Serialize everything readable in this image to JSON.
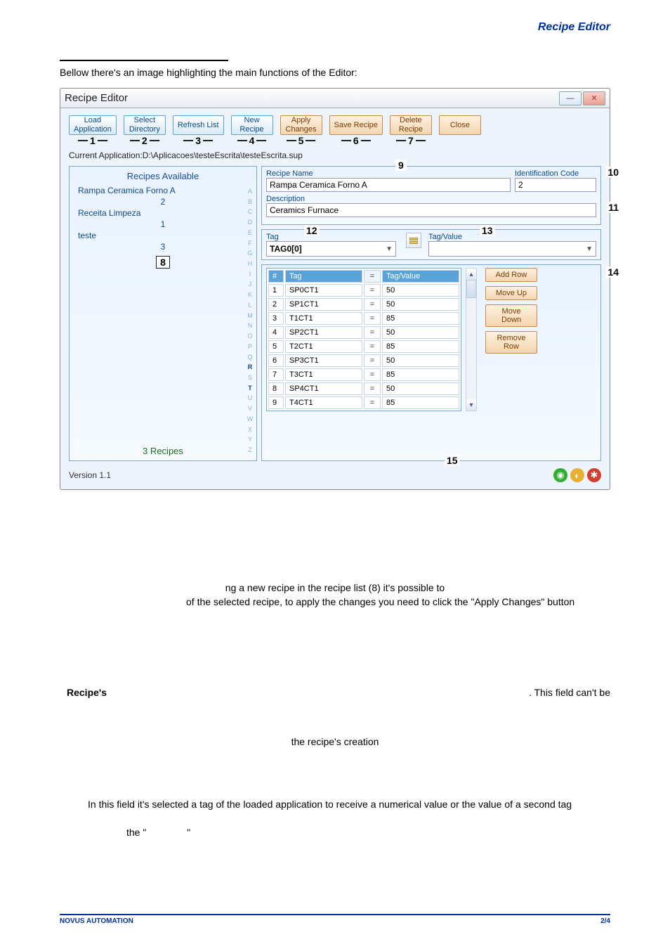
{
  "header": {
    "title": "Recipe Editor"
  },
  "intro": "Bellow there's an image highlighting the main functions of the Editor:",
  "win": {
    "title": "Recipe Editor",
    "toolbar": [
      {
        "label": "Load\nApplication",
        "num": "1",
        "warm": false
      },
      {
        "label": "Select\nDirectory",
        "num": "2",
        "warm": false
      },
      {
        "label": "Refresh List",
        "num": "3",
        "warm": false
      },
      {
        "label": "New\nRecipe",
        "num": "4",
        "warm": false
      },
      {
        "label": "Apply\nChanges",
        "num": "5",
        "warm": true
      },
      {
        "label": "Save Recipe",
        "num": "6",
        "warm": true
      },
      {
        "label": "Delete\nRecipe",
        "num": "7",
        "warm": true
      },
      {
        "label": "Close",
        "num": "",
        "warm": true
      }
    ],
    "path": "Current Application:D:\\Aplicacoes\\testeEscrita\\testeEscrita.sup",
    "left": {
      "header": "Recipes  Available",
      "rows": [
        {
          "name": "Rampa Ceramica Forno A",
          "count": "2"
        },
        {
          "name": "Receita Limpeza",
          "count": "1"
        },
        {
          "name": "teste",
          "count": "3"
        }
      ],
      "callnum": "8",
      "footer": "3 Recipes",
      "az": [
        "A",
        "B",
        "C",
        "D",
        "E",
        "F",
        "G",
        "H",
        "I",
        "J",
        "K",
        "L",
        "M",
        "N",
        "O",
        "P",
        "Q",
        "R",
        "S",
        "T",
        "U",
        "V",
        "W",
        "X",
        "Y",
        "Z"
      ],
      "azHot": [
        "R",
        "T"
      ]
    },
    "right": {
      "recipeNameLabel": "Recipe Name",
      "recipeName": "Rampa Ceramica Forno A",
      "idCodeLabel": "Identification Code",
      "idCode": "2",
      "descLabel": "Description",
      "desc": "Ceramics Furnace",
      "tagLabel": "Tag",
      "tagValueLabel": "Tag/Value",
      "tagCombo": "TAG0[0]",
      "callouts": {
        "nine": "9",
        "ten": "10",
        "eleven": "11",
        "twelve": "12",
        "thirteen": "13",
        "fourteen": "14",
        "fifteen": "15"
      },
      "columns": {
        "num": "#",
        "tag": "Tag",
        "eq": "=",
        "val": "Tag/Value"
      },
      "rows": [
        {
          "n": "1",
          "tag": "SP0CT1",
          "val": "50"
        },
        {
          "n": "2",
          "tag": "SP1CT1",
          "val": "50"
        },
        {
          "n": "3",
          "tag": "T1CT1",
          "val": "85"
        },
        {
          "n": "4",
          "tag": "SP2CT1",
          "val": "50"
        },
        {
          "n": "5",
          "tag": "T2CT1",
          "val": "85"
        },
        {
          "n": "6",
          "tag": "SP3CT1",
          "val": "50"
        },
        {
          "n": "7",
          "tag": "T3CT1",
          "val": "85"
        },
        {
          "n": "8",
          "tag": "SP4CT1",
          "val": "50"
        },
        {
          "n": "9",
          "tag": "T4CT1",
          "val": "85"
        }
      ],
      "buttons": {
        "add": "Add Row",
        "up": "Move Up",
        "down": "Move\nDown",
        "remove": "Remove\nRow"
      }
    },
    "version": "Version  1.1"
  },
  "docbody": {
    "frag1": "ng a new recipe in the recipe list (8) it's possible to",
    "frag2": "of the selected recipe, to apply the changes you need to click the \"Apply Changes\" button",
    "frag3a": "Recipe's",
    "frag3b": ". This field can't be",
    "frag4": "the recipe's creation",
    "frag5": "In this field it's selected a tag of the loaded application to receive a numerical value or the value of a second tag",
    "frag6a": "the \"",
    "frag6b": "\""
  },
  "footer": {
    "company": "NOVUS AUTOMATION",
    "page": "2/4"
  }
}
